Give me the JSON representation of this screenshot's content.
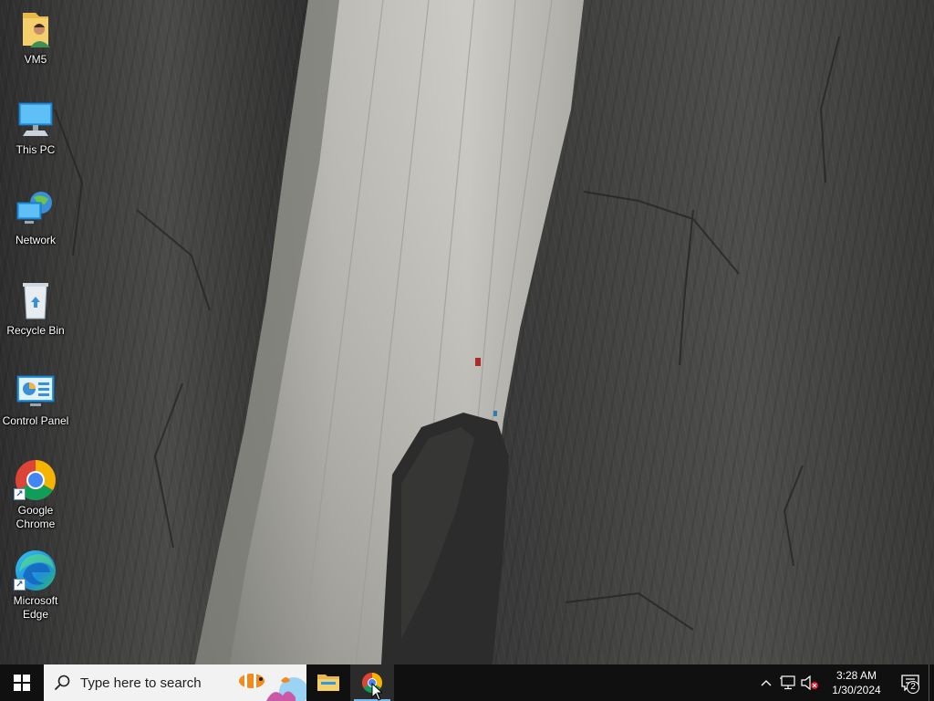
{
  "desktop": {
    "icons": [
      {
        "label": "VM5",
        "icon": "user-folder-icon"
      },
      {
        "label": "This PC",
        "icon": "this-pc-icon"
      },
      {
        "label": "Network",
        "icon": "network-icon"
      },
      {
        "label": "Recycle Bin",
        "icon": "recycle-bin-icon"
      },
      {
        "label": "Control Panel",
        "icon": "control-panel-icon"
      },
      {
        "label": "Google Chrome",
        "icon": "chrome-icon"
      },
      {
        "label": "Microsoft Edge",
        "icon": "edge-icon"
      }
    ]
  },
  "taskbar": {
    "search_placeholder": "Type here to search",
    "pinned": [
      {
        "name": "File Explorer",
        "icon": "file-explorer-icon"
      },
      {
        "name": "Google Chrome",
        "icon": "chrome-icon",
        "active": true
      }
    ],
    "clock": {
      "time": "3:28 AM",
      "date": "1/30/2024"
    },
    "notification_count": "2"
  },
  "colors": {
    "taskbar_bg": "#101010",
    "search_bg": "#f2f2f2",
    "active_underline": "#76b9ed",
    "windows_blue": "#0078d7"
  }
}
